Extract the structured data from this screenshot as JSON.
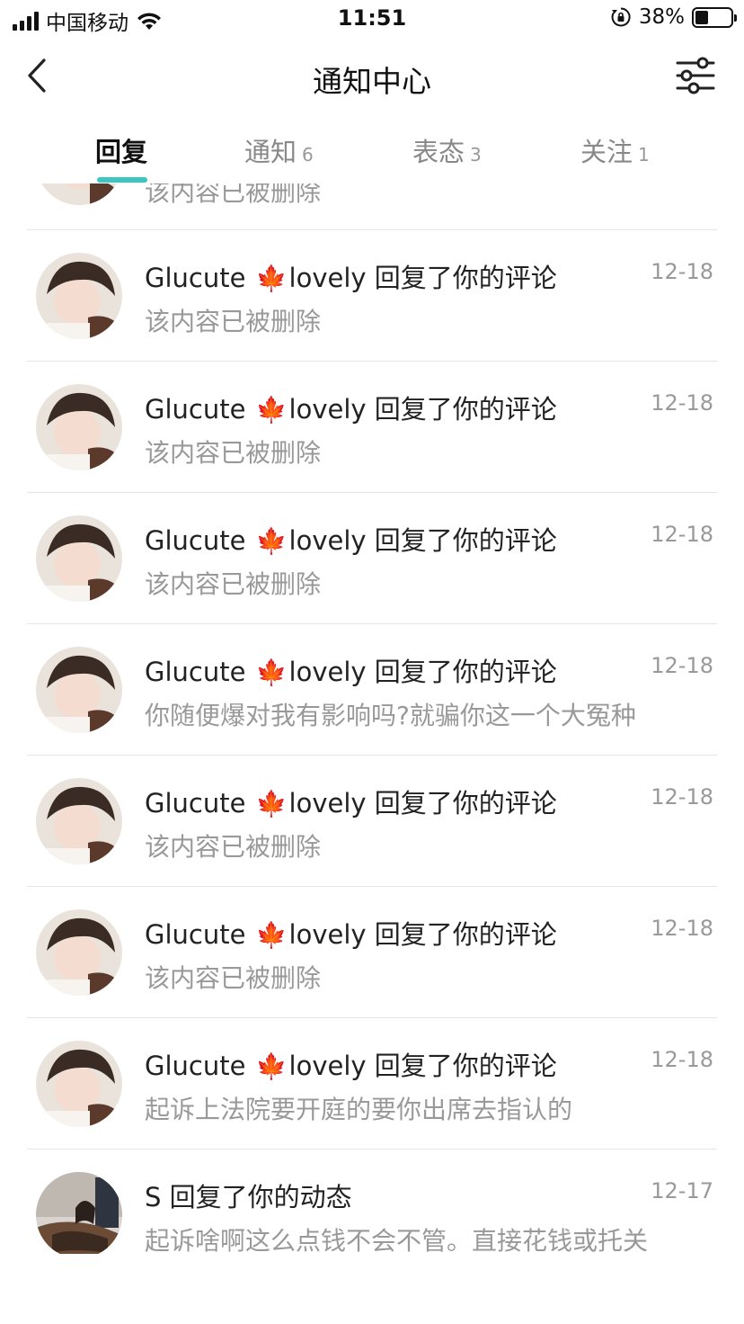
{
  "status_bar": {
    "carrier": "中国移动",
    "time": "11:51",
    "battery_percent_label": "38%",
    "battery_level": 0.38
  },
  "nav": {
    "title": "通知中心"
  },
  "tabs": [
    {
      "label": "回复",
      "count": ""
    },
    {
      "label": "通知",
      "count": "6"
    },
    {
      "label": "表态",
      "count": "3"
    },
    {
      "label": "关注",
      "count": "1"
    }
  ],
  "partial_item": {
    "text": "该内容已被删除"
  },
  "items": [
    {
      "name": "Glucute",
      "name_suffix": "lovely",
      "action": "回复了你的评论",
      "date": "12-18",
      "text": "该内容已被删除"
    },
    {
      "name": "Glucute",
      "name_suffix": "lovely",
      "action": "回复了你的评论",
      "date": "12-18",
      "text": "该内容已被删除"
    },
    {
      "name": "Glucute",
      "name_suffix": "lovely",
      "action": "回复了你的评论",
      "date": "12-18",
      "text": "该内容已被删除"
    },
    {
      "name": "Glucute",
      "name_suffix": "lovely",
      "action": "回复了你的评论",
      "date": "12-18",
      "text": "你随便爆对我有影响吗?就骗你这一个大冤种"
    },
    {
      "name": "Glucute",
      "name_suffix": "lovely",
      "action": "回复了你的评论",
      "date": "12-18",
      "text": "该内容已被删除"
    },
    {
      "name": "Glucute",
      "name_suffix": "lovely",
      "action": "回复了你的评论",
      "date": "12-18",
      "text": "该内容已被删除"
    },
    {
      "name": "Glucute",
      "name_suffix": "lovely",
      "action": "回复了你的评论",
      "date": "12-18",
      "text": "起诉上法院要开庭的要你出席去指认的"
    },
    {
      "name": "S",
      "name_suffix": "",
      "action": "回复了你的动态",
      "date": "12-17",
      "text": "起诉啥啊这么点钱不会不管。直接花钱或托关"
    }
  ],
  "icons": {
    "back": "chevron-left-icon",
    "filter": "sliders-icon",
    "leaf": "maple-leaf-icon",
    "rotation_lock": "rotation-lock-icon",
    "wifi": "wifi-icon"
  },
  "colors": {
    "accent": "#3ec5c0",
    "secondary_text": "#999999",
    "leaf": "#c8451c"
  }
}
